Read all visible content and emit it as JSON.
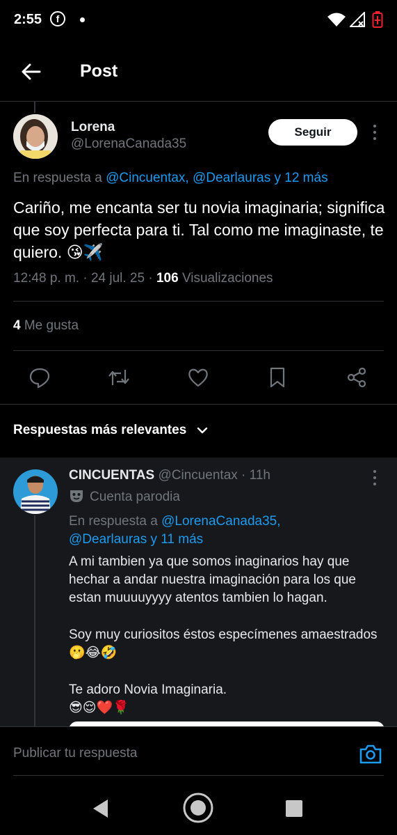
{
  "status_bar": {
    "time": "2:55",
    "fb_glyph": "f"
  },
  "header": {
    "title": "Post"
  },
  "post": {
    "author_name": "Lorena",
    "author_handle": "@LorenaCanada35",
    "follow_label": "Seguir",
    "reply_prefix": "En respuesta a",
    "reply_to": "@Cincuentax, @Dearlauras y 12 más",
    "text": "Cariño, me encanta ser tu novia imaginaria; significa que soy perfecta para ti. Tal como me imaginaste, te quiero. 😘✈️",
    "time": "12:48 p. m. · 24 jul. 25 · ",
    "views_count": "106",
    "views_label": "Visualizaciones",
    "likes_count": "4",
    "likes_label": "Me gusta"
  },
  "replies_section": {
    "title": "Respuestas más relevantes"
  },
  "reply": {
    "author_name": "CINCUENTAS",
    "author_handle": "@Cincuentax · 11h",
    "parody_label": "Cuenta parodia",
    "reply_prefix": "En respuesta a",
    "reply_to_1": "@LorenaCanada35,",
    "reply_to_2": "@Dearlauras y 11 más",
    "paragraph_1": "A mi tambien ya que somos inaginarios hay que hechar a andar nuestra imaginación para los que estan muuuuyyyy atentos tambien lo hagan.",
    "paragraph_2": "Soy muy curiositos éstos especímenes amaestrados 🫢😂🤣",
    "paragraph_3": "Te adoro Novia Imaginaria.",
    "paragraph_4": "😎😌❤️🌹"
  },
  "compose": {
    "placeholder": "Publicar tu respuesta"
  },
  "colors": {
    "accent": "#1d9bf0",
    "background": "#000000",
    "muted": "#71767b",
    "battery": "#f4212e"
  }
}
